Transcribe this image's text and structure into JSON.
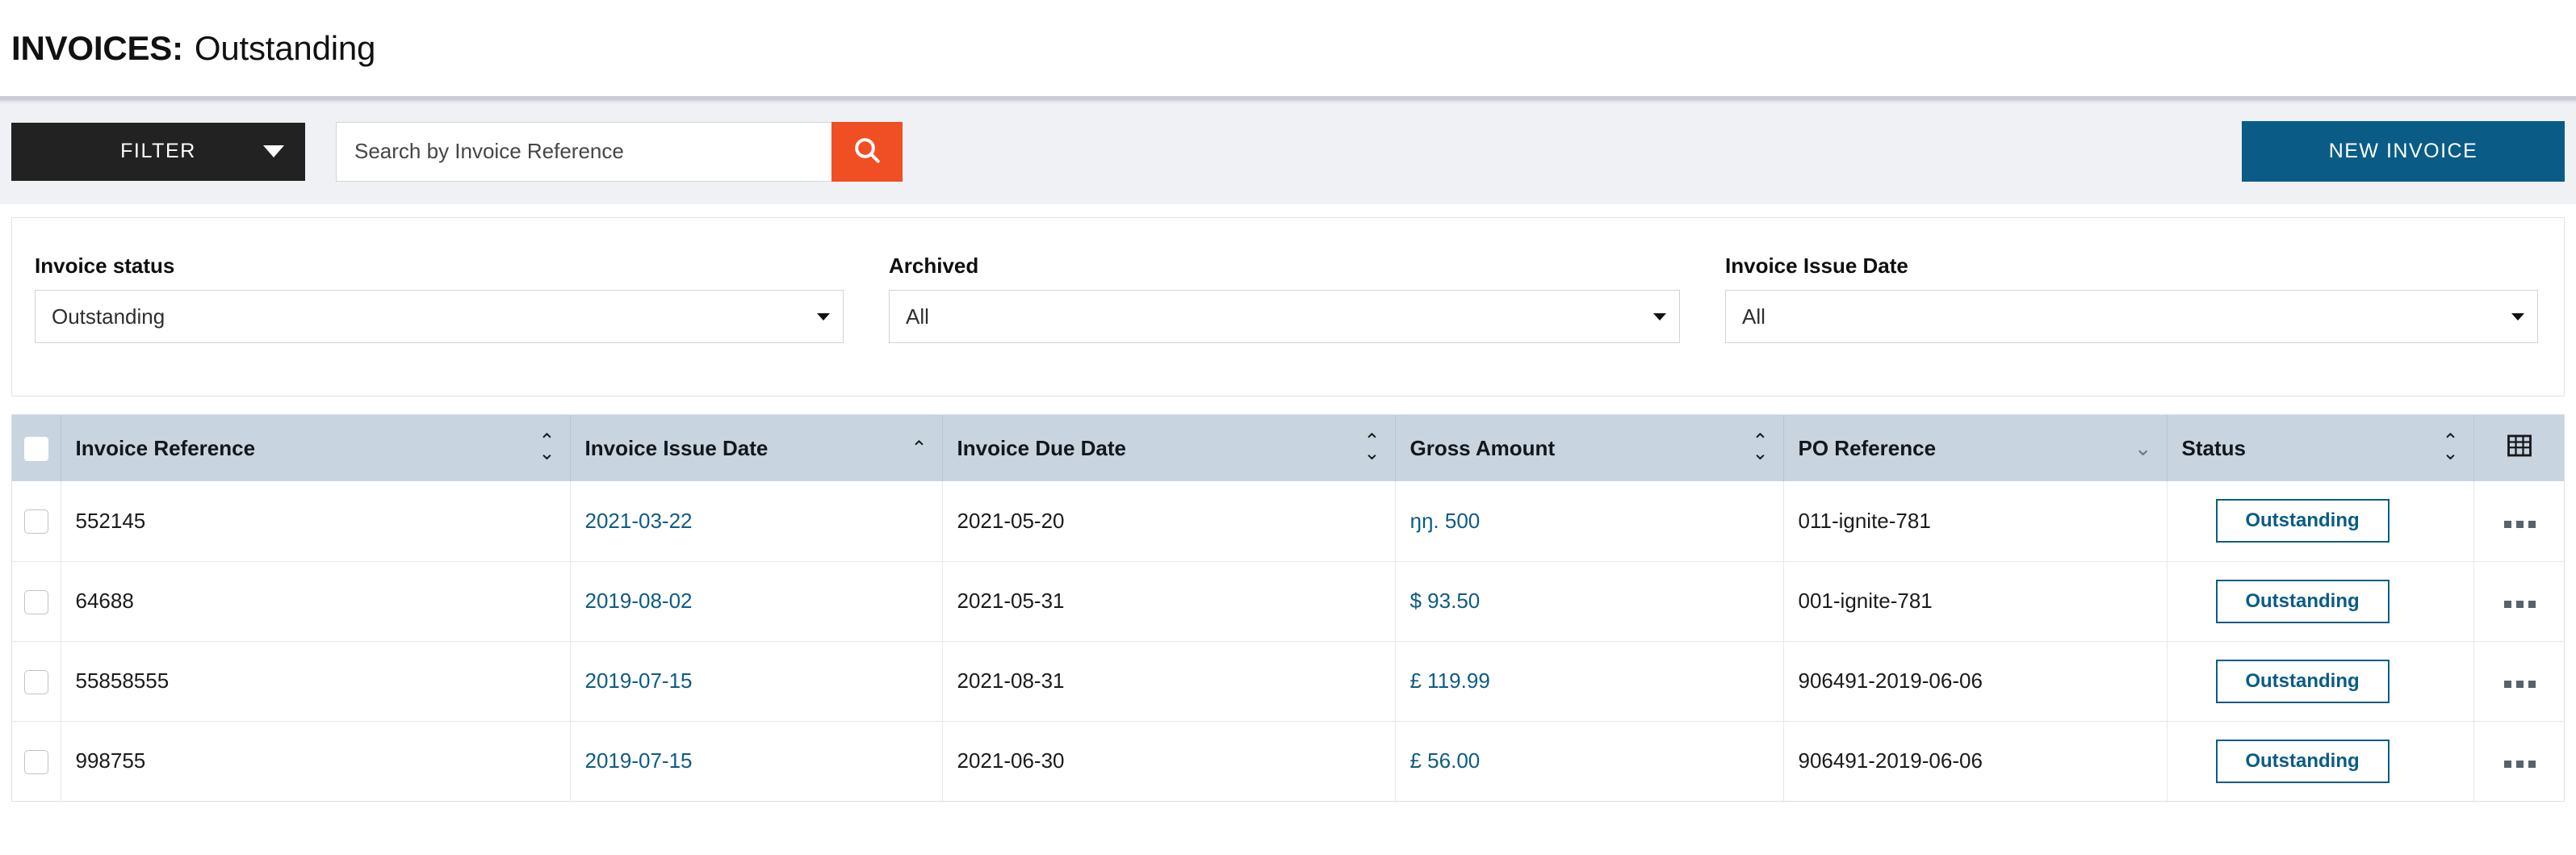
{
  "header": {
    "title_strong": "INVOICES:",
    "title_light": "Outstanding"
  },
  "toolbar": {
    "filter_label": "FILTER",
    "filter_caret_icon": "caret-down-icon",
    "search_placeholder": "Search by Invoice Reference",
    "search_value": "",
    "search_icon": "search-icon",
    "new_invoice_label": "NEW INVOICE",
    "accent_orange": "#f04e23",
    "accent_blue": "#0a5c86",
    "filter_bg": "#222222"
  },
  "filters": [
    {
      "label": "Invoice status",
      "value": "Outstanding",
      "caret_icon": "caret-down-icon"
    },
    {
      "label": "Archived",
      "value": "All",
      "caret_icon": "caret-down-icon"
    },
    {
      "label": "Invoice Issue Date",
      "value": "All",
      "caret_icon": "caret-down-icon"
    }
  ],
  "table": {
    "select_all_icon": "checkbox-unchecked-icon",
    "grid_settings_icon": "table-grid-icon",
    "row_menu_icon": "ellipsis-horizontal-icon",
    "row_checkbox_icon": "checkbox-unchecked-icon",
    "columns": [
      {
        "label": "Invoice Reference",
        "sort": "both"
      },
      {
        "label": "Invoice Issue Date",
        "sort": "asc"
      },
      {
        "label": "Invoice Due Date",
        "sort": "both"
      },
      {
        "label": "Gross Amount",
        "sort": "both"
      },
      {
        "label": "PO Reference",
        "sort": "desc"
      },
      {
        "label": "Status",
        "sort": "both"
      }
    ],
    "sort_glyphs": {
      "up": "⌃",
      "down": "⌄"
    },
    "rows": [
      {
        "reference": "552145",
        "issue_date": "2021-03-22",
        "due_date": "2021-05-20",
        "gross_amount": "ŋŋ. 500",
        "po_reference": "011-ignite-781",
        "status": "Outstanding"
      },
      {
        "reference": "64688",
        "issue_date": "2019-08-02",
        "due_date": "2021-05-31",
        "gross_amount": "$ 93.50",
        "po_reference": "001-ignite-781",
        "status": "Outstanding"
      },
      {
        "reference": "55858555",
        "issue_date": "2019-07-15",
        "due_date": "2021-08-31",
        "gross_amount": "£ 119.99",
        "po_reference": "906491-2019-06-06",
        "status": "Outstanding"
      },
      {
        "reference": "998755",
        "issue_date": "2019-07-15",
        "due_date": "2021-06-30",
        "gross_amount": "£ 56.00",
        "po_reference": "906491-2019-06-06",
        "status": "Outstanding"
      }
    ]
  }
}
